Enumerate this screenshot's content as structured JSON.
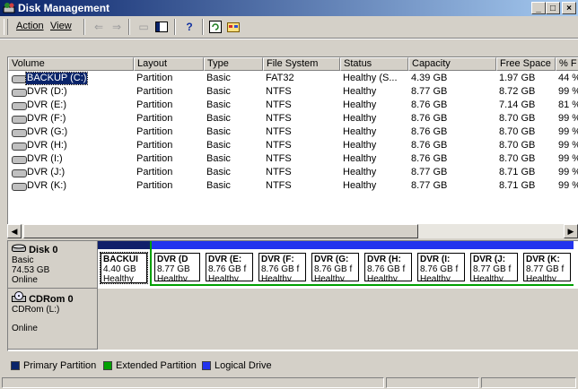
{
  "window": {
    "title": "Disk Management",
    "min": "_",
    "max": "□",
    "close": "×"
  },
  "menu": {
    "action": "Action",
    "view": "View"
  },
  "colors": {
    "primary": "#0a246a",
    "extended": "#00a000",
    "logical": "#2233ee",
    "boot": "#10206a"
  },
  "volumes": {
    "headers": [
      "Volume",
      "Layout",
      "Type",
      "File System",
      "Status",
      "Capacity",
      "Free Space",
      "% F"
    ],
    "rows": [
      {
        "name": "BACKUP (C:)",
        "layout": "Partition",
        "type": "Basic",
        "fs": "FAT32",
        "status": "Healthy (S...",
        "capacity": "4.39 GB",
        "free": "1.97 GB",
        "pct": "44 %"
      },
      {
        "name": "DVR (D:)",
        "layout": "Partition",
        "type": "Basic",
        "fs": "NTFS",
        "status": "Healthy",
        "capacity": "8.77 GB",
        "free": "8.72 GB",
        "pct": "99 %"
      },
      {
        "name": "DVR (E:)",
        "layout": "Partition",
        "type": "Basic",
        "fs": "NTFS",
        "status": "Healthy",
        "capacity": "8.76 GB",
        "free": "7.14 GB",
        "pct": "81 %"
      },
      {
        "name": "DVR (F:)",
        "layout": "Partition",
        "type": "Basic",
        "fs": "NTFS",
        "status": "Healthy",
        "capacity": "8.76 GB",
        "free": "8.70 GB",
        "pct": "99 %"
      },
      {
        "name": "DVR (G:)",
        "layout": "Partition",
        "type": "Basic",
        "fs": "NTFS",
        "status": "Healthy",
        "capacity": "8.76 GB",
        "free": "8.70 GB",
        "pct": "99 %"
      },
      {
        "name": "DVR (H:)",
        "layout": "Partition",
        "type": "Basic",
        "fs": "NTFS",
        "status": "Healthy",
        "capacity": "8.76 GB",
        "free": "8.70 GB",
        "pct": "99 %"
      },
      {
        "name": "DVR (I:)",
        "layout": "Partition",
        "type": "Basic",
        "fs": "NTFS",
        "status": "Healthy",
        "capacity": "8.76 GB",
        "free": "8.70 GB",
        "pct": "99 %"
      },
      {
        "name": "DVR (J:)",
        "layout": "Partition",
        "type": "Basic",
        "fs": "NTFS",
        "status": "Healthy",
        "capacity": "8.77 GB",
        "free": "8.71 GB",
        "pct": "99 %"
      },
      {
        "name": "DVR (K:)",
        "layout": "Partition",
        "type": "Basic",
        "fs": "NTFS",
        "status": "Healthy",
        "capacity": "8.77 GB",
        "free": "8.71 GB",
        "pct": "99 %"
      }
    ]
  },
  "disk0": {
    "name": "Disk 0",
    "type": "Basic",
    "size": "74.53 GB",
    "state": "Online",
    "partitions": [
      {
        "label": "BACKUI",
        "size": "4.40 GB",
        "status": "Healthy",
        "kind": "primary"
      },
      {
        "label": "DVR (D",
        "size": "8.77 GB",
        "status": "Healthy",
        "kind": "logical"
      },
      {
        "label": "DVR (E:",
        "size": "8.76 GB f",
        "status": "Healthy",
        "kind": "logical"
      },
      {
        "label": "DVR (F:",
        "size": "8.76 GB f",
        "status": "Healthy",
        "kind": "logical"
      },
      {
        "label": "DVR (G:",
        "size": "8.76 GB f",
        "status": "Healthy",
        "kind": "logical"
      },
      {
        "label": "DVR (H:",
        "size": "8.76 GB f",
        "status": "Healthy",
        "kind": "logical"
      },
      {
        "label": "DVR (I:",
        "size": "8.76 GB f",
        "status": "Healthy",
        "kind": "logical"
      },
      {
        "label": "DVR (J:",
        "size": "8.77 GB f",
        "status": "Healthy",
        "kind": "logical"
      },
      {
        "label": "DVR (K:",
        "size": "8.77 GB f",
        "status": "Healthy",
        "kind": "logical"
      }
    ]
  },
  "cdrom0": {
    "name": "CDRom 0",
    "type": "CDRom (L:)",
    "state": "Online"
  },
  "legend": {
    "primary": "Primary Partition",
    "extended": "Extended Partition",
    "logical": "Logical Drive"
  }
}
